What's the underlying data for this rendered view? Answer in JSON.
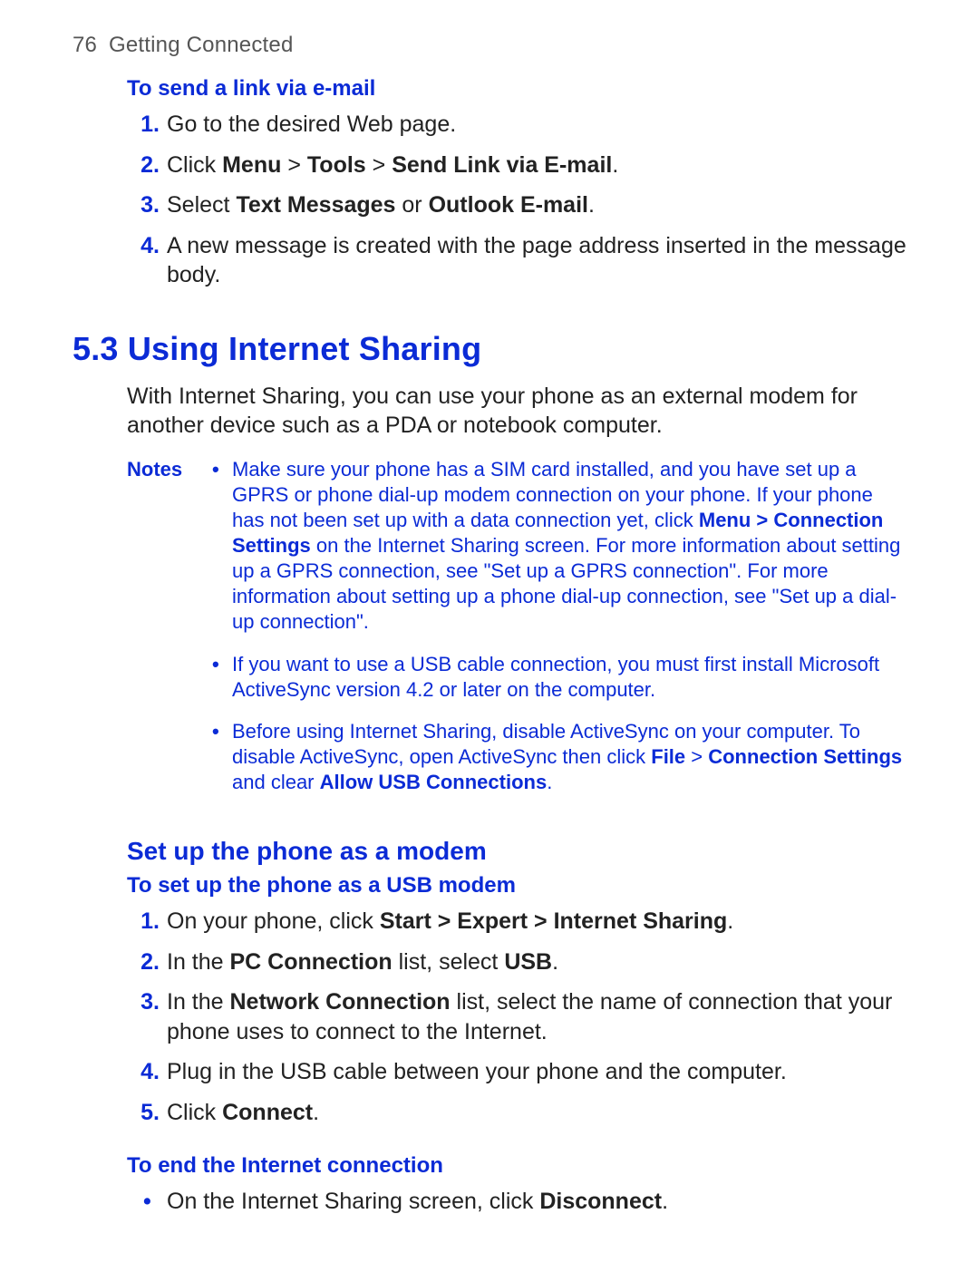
{
  "header": {
    "page_number": "76",
    "chapter": "Getting Connected"
  },
  "sec1": {
    "title": "To send a link via e-mail",
    "steps": {
      "n1": "1.",
      "s1": "Go to the desired Web page.",
      "n2": "2.",
      "s2a": "Click ",
      "s2b": "Menu",
      "s2c": " > ",
      "s2d": "Tools",
      "s2e": " > ",
      "s2f": "Send Link via E-mail",
      "s2g": ".",
      "n3": "3.",
      "s3a": "Select ",
      "s3b": "Text Messages",
      "s3c": " or ",
      "s3d": "Outlook E-mail",
      "s3e": ".",
      "n4": "4.",
      "s4": "A new message is created with the page address inserted in the message body."
    }
  },
  "sec2": {
    "title": "5.3 Using Internet Sharing",
    "intro": "With Internet Sharing, you can use your phone as an external modem for another device such as a PDA or notebook computer.",
    "notes_label": "Notes",
    "note1": {
      "a": "Make sure your phone has a SIM card installed, and you have set up a GPRS or phone dial-up modem connection on your phone. If your phone has not been set up with a data connection yet, click ",
      "b": "Menu > Connection Settings",
      "c": " on the Internet Sharing screen. For more information about setting up a GPRS connection, see \"Set up a GPRS connection\". For more information about setting up a phone dial-up connection, see \"Set up a dial-up connection\"."
    },
    "note2": "If you want to use a USB cable connection, you must first install Microsoft ActiveSync version 4.2 or later on the computer.",
    "note3": {
      "a": "Before using Internet Sharing, disable ActiveSync on your computer. To disable ActiveSync, open ActiveSync then click ",
      "b": "File",
      "c": " > ",
      "d": "Connection Settings",
      "e": " and clear ",
      "f": "Allow USB Connections",
      "g": "."
    }
  },
  "sec3": {
    "title": "Set up the phone as a modem",
    "sub1": "To set up the phone as a USB modem",
    "steps": {
      "n1": "1.",
      "s1a": "On your phone, click ",
      "s1b": "Start > Expert > Internet Sharing",
      "s1c": ".",
      "n2": "2.",
      "s2a": "In the ",
      "s2b": "PC Connection",
      "s2c": " list, select ",
      "s2d": "USB",
      "s2e": ".",
      "n3": "3.",
      "s3a": "In the ",
      "s3b": "Network Connection",
      "s3c": " list, select the name of connection that your phone uses to connect to the Internet.",
      "n4": "4.",
      "s4": "Plug in the USB cable between your phone and the computer.",
      "n5": "5.",
      "s5a": "Click ",
      "s5b": "Connect",
      "s5c": "."
    },
    "sub2": "To end the Internet connection",
    "end": {
      "a": "On the Internet Sharing screen, click ",
      "b": "Disconnect",
      "c": "."
    }
  }
}
